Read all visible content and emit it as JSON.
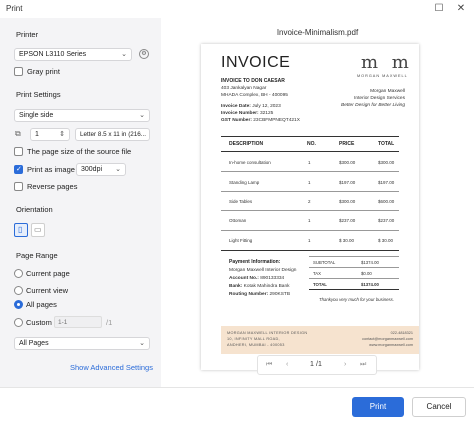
{
  "window": {
    "title": "Print"
  },
  "left": {
    "printer_section": "Printer",
    "printer_value": "EPSON L3110 Series",
    "gray_print": "Gray print",
    "print_settings_section": "Print Settings",
    "sides_value": "Single side",
    "copies_value": "1",
    "paper_value": "Letter 8.5 x 11 in (216...",
    "source_size": "The page size of the source file",
    "print_as_image": "Print as image",
    "dpi_value": "300dpi",
    "reverse_pages": "Reverse pages",
    "orientation_section": "Orientation",
    "page_range_section": "Page Range",
    "range_current_page": "Current page",
    "range_current_view": "Current view",
    "range_all_pages": "All pages",
    "range_custom": "Custom",
    "custom_placeholder": "1-1",
    "custom_total": "/1",
    "pages_subset_value": "All Pages",
    "advanced_link": "Show Advanced Settings"
  },
  "preview": {
    "file_name": "Invoice-Minimalism.pdf",
    "pager_current": "1",
    "pager_total": "/1",
    "invoice": {
      "title": "INVOICE",
      "invoice_to": "INVOICE TO DON CAESAR",
      "addr_line1": "403 Jankalyan Nagar",
      "addr_line2": "MHADA Complex, BH - 400095",
      "date_label": "Invoice Date:",
      "date_value": "July 12, 2023",
      "number_label": "Invoice Number:",
      "number_value": "32125",
      "gst_label": "GST Number:",
      "gst_value": "23CBFMPNEQT421X",
      "logo_text": "m m",
      "logo_sub": "MORGAN MAXWELL",
      "company_name": "Morgan Maxwell",
      "company_line": "Interior Design Services",
      "company_tagline": "Better Design for Better Living",
      "columns": [
        "DESCRIPTION",
        "NO.",
        "PRICE",
        "TOTAL"
      ],
      "rows": [
        {
          "desc": "In-home consultation",
          "no": "1",
          "price": "$300.00",
          "total": "$300.00"
        },
        {
          "desc": "Standing Lamp",
          "no": "1",
          "price": "$197.00",
          "total": "$197.00"
        },
        {
          "desc": "Side Tables",
          "no": "2",
          "price": "$300.00",
          "total": "$600.00"
        },
        {
          "desc": "Ottoman",
          "no": "1",
          "price": "$237.00",
          "total": "$237.00"
        },
        {
          "desc": "Light Fitting",
          "no": "1",
          "price": "$ 30.00",
          "total": "$ 30.00"
        }
      ],
      "payment_head": "Payment Information:",
      "payment_name": "Morgan Maxwell Interior Design",
      "account_label": "Account No.:",
      "account_value": "890133334",
      "bank_label": "Bank:",
      "bank_value": "Kotak Mahindra Bank",
      "routing_label": "Routing Number:",
      "routing_value": "290KSTB",
      "subtotal_label": "SUBTOTAL",
      "subtotal_value": "$1374.00",
      "tax_label": "TAX",
      "tax_value": "$0.00",
      "total_label": "TOTAL",
      "total_value": "$1374.00",
      "thanks": "Thankyou very much for your business.",
      "footer_left1": "MORGAN MAXWELL INTERIOR DESIGN",
      "footer_left2": "10, INFINITY MALL ROAD,",
      "footer_left3": "ANDHERI, MUMBAI - 400053",
      "footer_right1": "022-4818321",
      "footer_right2": "contact@morganmaxwell.com",
      "footer_right3": "www.morganmaxwell.com"
    }
  },
  "buttons": {
    "print": "Print",
    "cancel": "Cancel"
  },
  "colors": {
    "accent": "#2b6cd9",
    "footer_band": "#f6e3cf",
    "panel_bg": "#f4f4f6"
  }
}
